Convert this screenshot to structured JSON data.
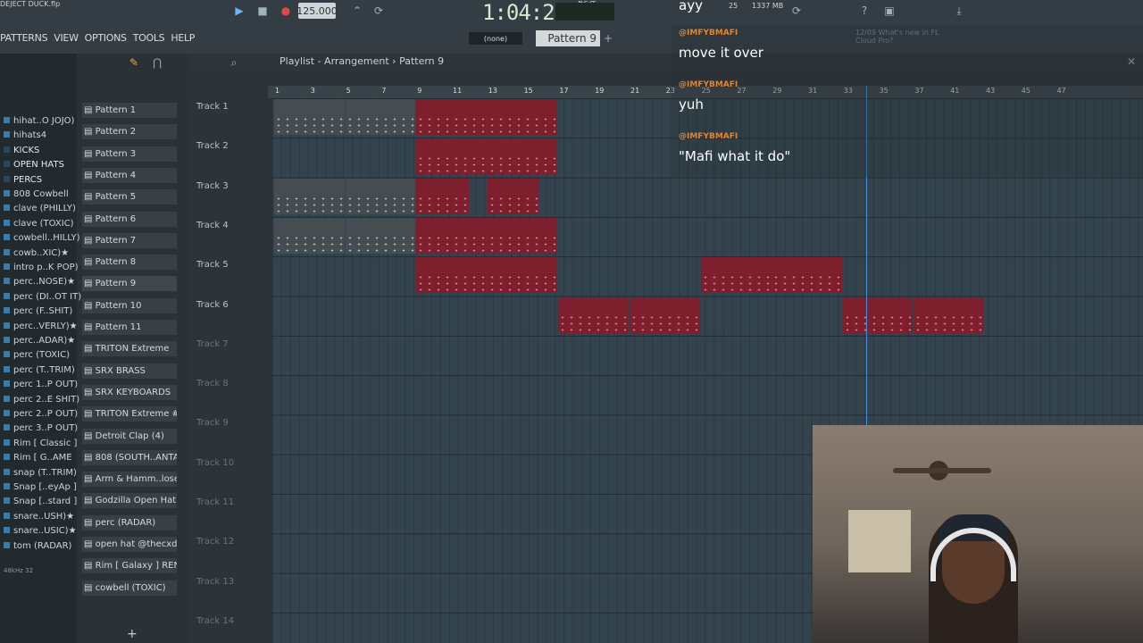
{
  "app": {
    "title": "DEJECT DUCK.flp",
    "bpm": "125.000",
    "time": "1:04:25",
    "time_unit": "M:S:CS",
    "memory": "1337 MB",
    "cpu": "25"
  },
  "menu": [
    "PATTERNS",
    "VIEW",
    "OPTIONS",
    "TOOLS",
    "HELP"
  ],
  "toolbar": {
    "snap": "(none)",
    "pattern": "Pattern 9",
    "news": "12/09  What's new in FL Cloud Pro?"
  },
  "playlist": {
    "title": "Playlist - Arrangement",
    "pattern": "Pattern 9"
  },
  "ruler": [
    "1",
    "3",
    "5",
    "7",
    "9",
    "11",
    "13",
    "15",
    "17",
    "19",
    "21",
    "23",
    "25",
    "27",
    "29",
    "31",
    "33",
    "35",
    "37",
    "41",
    "43",
    "45",
    "47"
  ],
  "browser": [
    {
      "label": "hihat..O JOJO)",
      "kind": "file"
    },
    {
      "label": "hihats4",
      "kind": "file"
    },
    {
      "label": "KICKS",
      "kind": "folder"
    },
    {
      "label": "OPEN HATS",
      "kind": "folder"
    },
    {
      "label": "PERCS",
      "kind": "folder"
    },
    {
      "label": "808 Cowbell",
      "kind": "file"
    },
    {
      "label": "clave (PHILLY)",
      "kind": "file"
    },
    {
      "label": "clave (TOXIC)",
      "kind": "file"
    },
    {
      "label": "cowbell..HILLY)",
      "kind": "file"
    },
    {
      "label": "cowb..XIC)★",
      "kind": "file"
    },
    {
      "label": "intro p..K POP)",
      "kind": "file"
    },
    {
      "label": "perc..NOSE)★",
      "kind": "file"
    },
    {
      "label": "perc (DI..OT IT)",
      "kind": "file"
    },
    {
      "label": "perc (F..SHIT)",
      "kind": "file"
    },
    {
      "label": "perc..VERLY)★",
      "kind": "file"
    },
    {
      "label": "perc..ADAR)★",
      "kind": "file"
    },
    {
      "label": "perc (TOXIC)",
      "kind": "file"
    },
    {
      "label": "perc (T..TRIM)",
      "kind": "file"
    },
    {
      "label": "perc 1..P OUT)",
      "kind": "file"
    },
    {
      "label": "perc 2..E SHIT)",
      "kind": "file"
    },
    {
      "label": "perc 2..P OUT)",
      "kind": "file"
    },
    {
      "label": "perc 3..P OUT)",
      "kind": "file"
    },
    {
      "label": "Rim [ Classic ]",
      "kind": "file"
    },
    {
      "label": "Rim [ G..AME",
      "kind": "file"
    },
    {
      "label": "snap (T..TRIM)",
      "kind": "file"
    },
    {
      "label": "Snap [..eyAp ]",
      "kind": "file"
    },
    {
      "label": "Snap [..stard ]",
      "kind": "file"
    },
    {
      "label": "snare..USH)★",
      "kind": "file"
    },
    {
      "label": "snare..USIC)★",
      "kind": "file"
    },
    {
      "label": "tom (RADAR)",
      "kind": "file"
    }
  ],
  "browser_footer": "48kHz 32",
  "channels": [
    "Pattern 1",
    "Pattern 2",
    "Pattern 3",
    "Pattern 4",
    "Pattern 5",
    "Pattern 6",
    "Pattern 7",
    "Pattern 8",
    "Pattern 9",
    "Pattern 10",
    "Pattern 11",
    "TRITON Extreme",
    "SRX BRASS",
    "SRX KEYBOARDS",
    "TRITON Extreme #2",
    "Detroit Clap (4)",
    "808 (SOUTH..ANTA BABY)",
    "Arm & Hamm..losed Hat",
    "Godzilla Open Hat",
    "perc (RADAR)",
    "open hat @thecxdy",
    "Rim [ Galaxy ] RENAME",
    "cowbell (TOXIC)"
  ],
  "tracks": [
    "Track 1",
    "Track 2",
    "Track 3",
    "Track 4",
    "Track 5",
    "Track 6",
    "Track 7",
    "Track 8",
    "Track 9",
    "Track 10",
    "Track 11",
    "Track 12",
    "Track 13",
    "Track 14"
  ],
  "clips": [
    {
      "track": 1,
      "bar": 1,
      "len": 4,
      "label": "TRITON Extreme",
      "color": "gray"
    },
    {
      "track": 1,
      "bar": 5,
      "len": 4,
      "label": "TRITON Extreme",
      "color": "gray"
    },
    {
      "track": 1,
      "bar": 9,
      "len": 4,
      "label": "TRITON Extreme",
      "color": "red"
    },
    {
      "track": 1,
      "bar": 13,
      "len": 4,
      "label": "TRITON Extreme",
      "color": "red"
    },
    {
      "track": 2,
      "bar": 9,
      "len": 4,
      "label": "SRX BRASS",
      "color": "red"
    },
    {
      "track": 2,
      "bar": 13,
      "len": 4,
      "label": "SRX BRASS",
      "color": "red"
    },
    {
      "track": 3,
      "bar": 1,
      "len": 4,
      "label": "SRX K..BOARDS",
      "color": "gray"
    },
    {
      "track": 3,
      "bar": 5,
      "len": 4,
      "label": "SRX K..BOARDS",
      "color": "gray"
    },
    {
      "track": 3,
      "bar": 9,
      "len": 3,
      "label": "SRX K..BOARDS",
      "color": "red"
    },
    {
      "track": 3,
      "bar": 13,
      "len": 3,
      "label": "SRX K..BOARDS",
      "color": "red"
    },
    {
      "track": 4,
      "bar": 1,
      "len": 4,
      "label": "TRITON Extreme #2",
      "color": "gray"
    },
    {
      "track": 4,
      "bar": 5,
      "len": 4,
      "label": "TRITON Extreme #2",
      "color": "gray"
    },
    {
      "track": 4,
      "bar": 9,
      "len": 4,
      "label": "TRITON Extreme #2",
      "color": "red"
    },
    {
      "track": 4,
      "bar": 13,
      "len": 4,
      "label": "TRITON Extreme #2",
      "color": "red"
    },
    {
      "track": 5,
      "bar": 9,
      "len": 4,
      "label": "808 (SOU..NTA BABY)",
      "color": "red"
    },
    {
      "track": 5,
      "bar": 13,
      "len": 4,
      "label": "808 (SOU..NTA BABY)",
      "color": "red"
    },
    {
      "track": 5,
      "bar": 25,
      "len": 4,
      "label": "Pattern 10",
      "color": "red"
    },
    {
      "track": 5,
      "bar": 29,
      "len": 4,
      "label": "Pattern 10",
      "color": "red"
    },
    {
      "track": 6,
      "bar": 17,
      "len": 4,
      "label": "Pattern 11",
      "color": "red"
    },
    {
      "track": 6,
      "bar": 21,
      "len": 4,
      "label": "Pattern 11",
      "color": "red"
    },
    {
      "track": 6,
      "bar": 33,
      "len": 4,
      "label": "Pattern 9",
      "color": "red"
    },
    {
      "track": 6,
      "bar": 37,
      "len": 4,
      "label": "Pattern 9",
      "color": "red"
    }
  ],
  "chat": [
    {
      "user": "@IMFYBMAFI",
      "msg": "ayy"
    },
    {
      "user": "@IMFYBMAFI",
      "msg": "move it over"
    },
    {
      "user": "@IMFYBMAFI",
      "msg": "yuh"
    },
    {
      "user": "@IMFYBMAFI",
      "msg": "\"Mafi what it do\""
    }
  ],
  "icons": [
    "play-icon",
    "stop-icon",
    "record-icon",
    "pencil-icon",
    "magnet-icon",
    "zoom-icon",
    "search-icon",
    "plus-icon",
    "close-icon"
  ],
  "colors": {
    "clip_red": "#7d1f2c",
    "clip_gray": "#454d52",
    "playhead": "#4a8cd6",
    "chat_user": "#e0852e"
  }
}
